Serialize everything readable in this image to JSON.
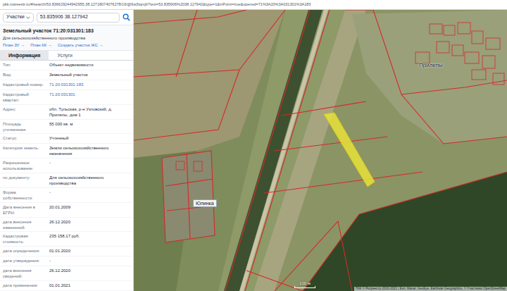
{
  "browser": {
    "url": "pkk.rosreestr.ru/#/search/53.836629244942955,38.12718074076278/16/@6w3tqrvjb?text=53.835906%2038.127942&type=1&inPoint=true&opened=71%3A20%3A031301%3A183"
  },
  "search": {
    "type": "Участки",
    "value": "53.835906 38.127942"
  },
  "card": {
    "title": "Земельный участок 71:20:031301:183",
    "subtitle": "Для сельскохозяйственного производства",
    "links": [
      "План ЗУ →",
      "План КК →",
      "Создать участок ЖС →"
    ]
  },
  "tabs": [
    {
      "label": "Информация",
      "selected": true
    },
    {
      "label": "Услуги",
      "selected": false
    }
  ],
  "fields": [
    {
      "label": "Тип:",
      "value": "Объект недвижимости",
      "kind": "text"
    },
    {
      "label": "Вид:",
      "value": "Земельный участок",
      "kind": "text"
    },
    {
      "label": "Кадастровый номер:",
      "value": "71:20:031301:183",
      "kind": "link"
    },
    {
      "label": "Кадастровый квартал:",
      "value": "71:20:031301",
      "kind": "link"
    },
    {
      "label": "Адрес:",
      "value": "обл. Тульская, р-н Узловский, д. Прилепы, дом 1",
      "kind": "text"
    },
    {
      "label": "Площадь уточненная:",
      "value": "55 000 кв. м",
      "kind": "text"
    },
    {
      "label": "Статус:",
      "value": "Учтенный",
      "kind": "text"
    },
    {
      "label": "Категория земель:",
      "value": "Земли сельскохозяйственного назначения",
      "kind": "text"
    },
    {
      "label": "Разрешенное использование:",
      "value": "-",
      "kind": "text"
    },
    {
      "label": "по документу:",
      "value": "Для сельскохозяйственного производства",
      "kind": "text"
    },
    {
      "label": "Форма собственности:",
      "value": "-",
      "kind": "text"
    },
    {
      "label": "Дата внесения в ЕГРН:",
      "value": "20.01.2009",
      "kind": "text"
    },
    {
      "label": "дата внесения изменений:",
      "value": "26.12.2020",
      "kind": "text"
    },
    {
      "label": "Кадастровая стоимость:",
      "value": "235 158,17 руб.",
      "kind": "text"
    },
    {
      "label": "дата определения:",
      "value": "01.01.2020",
      "kind": "text"
    },
    {
      "label": "дата утверждения:",
      "value": "-",
      "kind": "text"
    },
    {
      "label": "дата внесения сведений:",
      "value": "26.12.2020",
      "kind": "text"
    },
    {
      "label": "дата применения:",
      "value": "01.01.2021",
      "kind": "text"
    }
  ],
  "map": {
    "places": [
      {
        "name": "Прилепы",
        "kind": "plain"
      },
      {
        "name": "Юлинка",
        "kind": "boxed"
      }
    ],
    "scale": "100 м",
    "attribution": "ПКК © Росреестр 2010-2021 | Esri, Maxar, GeoEye, Earthstar Geographics, © Участники OpenStreetMap"
  }
}
